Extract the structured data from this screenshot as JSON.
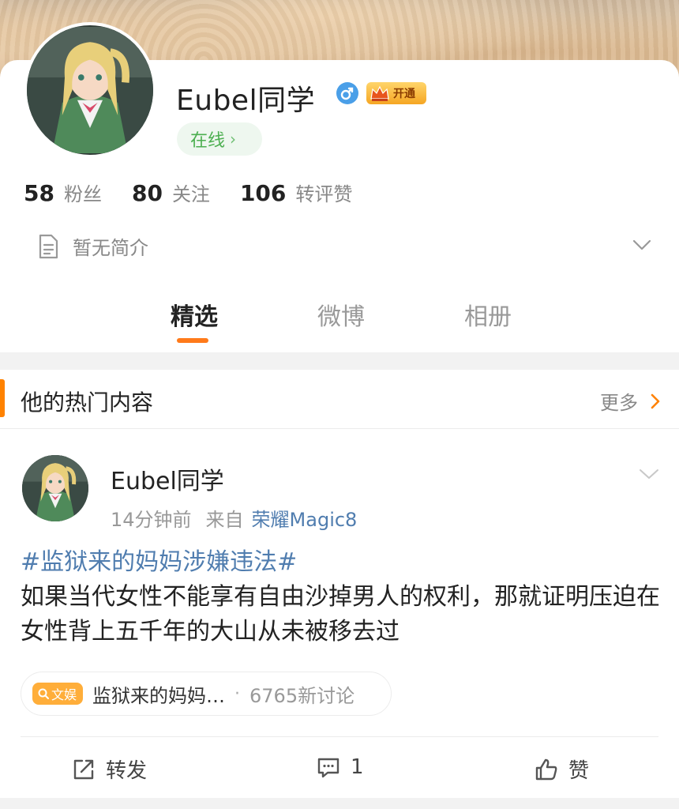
{
  "profile": {
    "username": "Eubel同学",
    "gender_icon": "male-icon",
    "vip_label": "开通",
    "status": "在线",
    "bio": "暂无简介",
    "stats": [
      {
        "value": "58",
        "label": "粉丝"
      },
      {
        "value": "80",
        "label": "关注"
      },
      {
        "value": "106",
        "label": "转评赞"
      }
    ]
  },
  "tabs": [
    {
      "label": "精选",
      "active": true
    },
    {
      "label": "微博",
      "active": false
    },
    {
      "label": "相册",
      "active": false
    }
  ],
  "section": {
    "title": "他的热门内容",
    "more_label": "更多"
  },
  "post": {
    "author": "Eubel同学",
    "time": "14分钟前",
    "source_prefix": "来自",
    "device": "荣耀Magic8",
    "hashtag": "#监狱来的妈妈涉嫌违法#",
    "text": "如果当代女性不能享有自由沙掉男人的权利，那就证明压迫在女性背上五千年的大山从未被移去过",
    "topic": {
      "badge": "文娱",
      "title": "监狱来的妈妈…",
      "separator": "·",
      "count": "6765新讨论"
    },
    "actions": {
      "repost": "转发",
      "comment": "1",
      "like": "赞"
    }
  },
  "colors": {
    "accent": "#ff8200",
    "link": "#507daf",
    "online": "#4caf50"
  }
}
